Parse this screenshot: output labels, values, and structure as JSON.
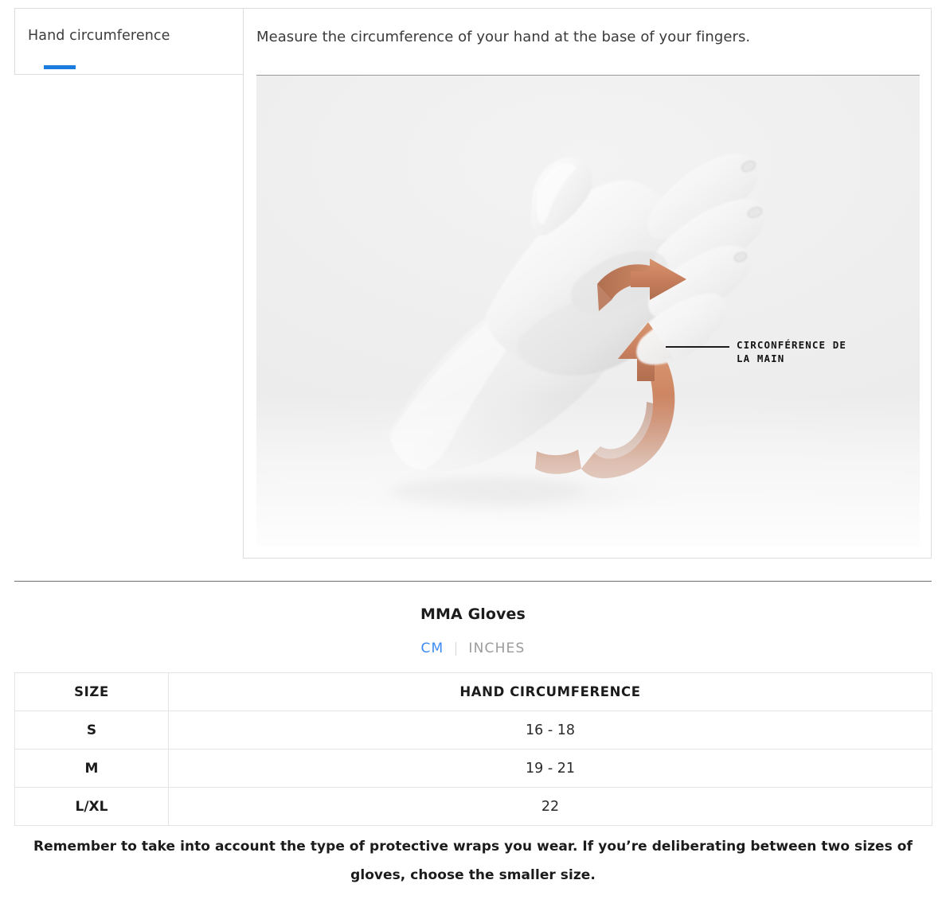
{
  "tabs": [
    {
      "label": "Hand circumference",
      "active": true
    }
  ],
  "content": {
    "description": "Measure the circumference of your hand at the base of your fingers.",
    "illustration": {
      "alt_name": "hand-circumference-illustration",
      "callout_text": "CIRCONFÉRENCE DE\nLA MAIN",
      "band_color": "#c9805e",
      "hand_color": "#f7f7f7",
      "background_color": "#ededed"
    }
  },
  "size_chart": {
    "title": "MMA Gloves",
    "units": {
      "active": "CM",
      "inactive": "INCHES",
      "separator": "|",
      "active_color": "#3d8bf2",
      "inactive_color": "#9b9b9b"
    },
    "columns": [
      "SIZE",
      "HAND CIRCUMFERENCE"
    ],
    "rows": [
      {
        "size": "S",
        "value": "16 - 18"
      },
      {
        "size": "M",
        "value": "19 - 21"
      },
      {
        "size": "L/XL",
        "value": "22"
      }
    ],
    "footnote": "Remember to take into account the type of protective wraps you wear. If you’re deliberating between two sizes of gloves, choose the smaller size."
  },
  "theme": {
    "accent_blue": "#1b7ce0",
    "border_light": "#dcdcdc",
    "border_strong": "#6e6e6e",
    "table_border": "#e4e4e4"
  }
}
